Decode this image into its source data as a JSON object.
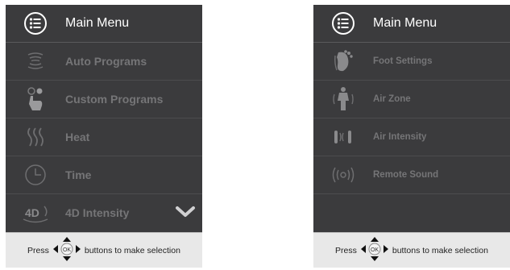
{
  "colors": {
    "panel_bg": "#3b3b3d",
    "dim_text": "#757577",
    "title_text": "#ffffff",
    "footer_bg": "#e8e8e8"
  },
  "left_panel": {
    "title": "Main Menu",
    "title_icon": "list-circle-icon",
    "items": [
      {
        "label": "Auto Programs",
        "icon": "wave-icon"
      },
      {
        "label": "Custom Programs",
        "icon": "hand-touch-icon"
      },
      {
        "label": "Heat",
        "icon": "heat-icon"
      },
      {
        "label": "Time",
        "icon": "clock-icon"
      },
      {
        "label": "4D Intensity",
        "icon": "intensity-4d-icon",
        "icon_text": "4D"
      }
    ],
    "footer": {
      "prefix": "Press",
      "ok": "OK",
      "suffix": "buttons to make selection"
    }
  },
  "right_panel": {
    "title": "Main Menu",
    "title_icon": "list-circle-icon",
    "items": [
      {
        "label": "Foot Settings",
        "icon": "foot-icon"
      },
      {
        "label": "Air Zone",
        "icon": "air-zone-icon"
      },
      {
        "label": "Air Intensity",
        "icon": "air-intensity-icon"
      },
      {
        "label": "Remote Sound",
        "icon": "remote-sound-icon"
      }
    ],
    "footer": {
      "prefix": "Press",
      "ok": "OK",
      "suffix": "buttons to make selection"
    }
  }
}
